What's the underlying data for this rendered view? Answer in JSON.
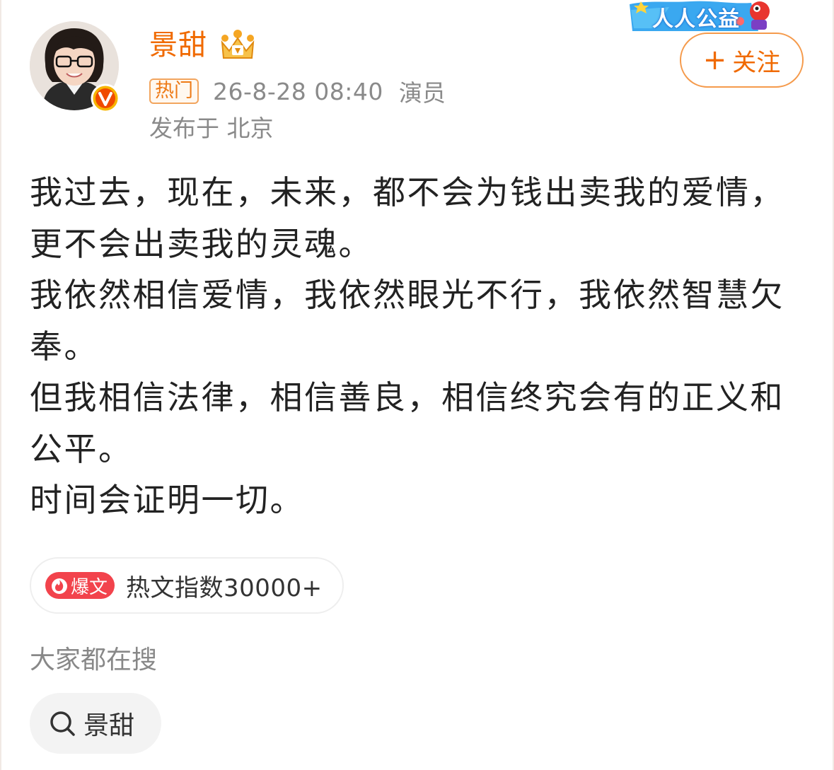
{
  "header": {
    "username": "景甜",
    "hot_tag": "热门",
    "timestamp": "26-8-28 08:40",
    "role": "演员",
    "location": "发布于 北京",
    "follow_label": "关注",
    "follow_plus": "+",
    "badge_text": "人人公益",
    "accent_color": "#f06a00"
  },
  "icons": {
    "avatar": "avatar-photo",
    "verified": "verified-v-icon",
    "crown": "crown-icon",
    "badge": "charity-badge",
    "baowen": "flame-icon",
    "search": "search-icon"
  },
  "post": {
    "paragraphs": [
      "我过去，现在，未来，都不会为钱出卖我的爱情，更不会出卖我的灵魂。",
      "我依然相信爱情，我依然眼光不行，我依然智慧欠奉。",
      "但我相信法律，相信善良，相信终究会有的正义和公平。",
      "时间会证明一切。"
    ]
  },
  "hot_article": {
    "tag_label": "爆文",
    "index_text": "热文指数30000+",
    "tag_color": "#f2434c"
  },
  "search": {
    "title": "大家都在搜",
    "chip_label": "景甜"
  }
}
